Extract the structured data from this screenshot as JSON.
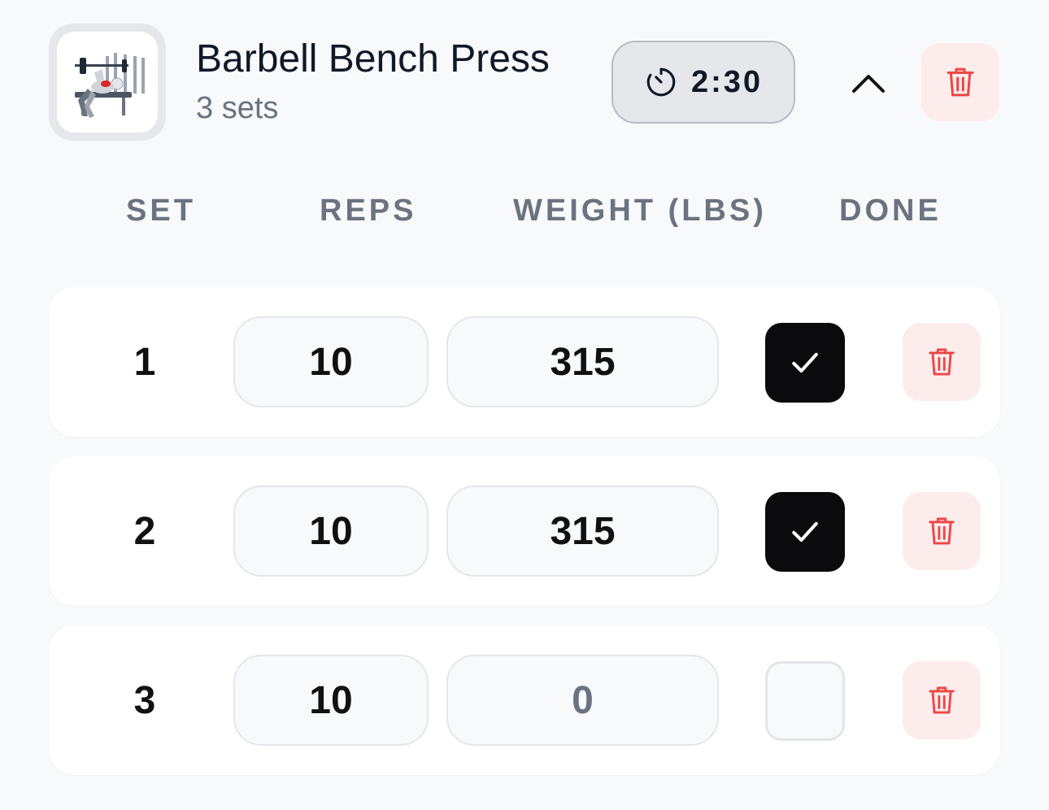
{
  "exercise": {
    "name": "Barbell Bench Press",
    "sets_label": "3 sets",
    "thumbnail_icon": "bench-press-illustration",
    "rest_timer": "2:30",
    "rest_timer_icon": "timer-icon",
    "collapse_icon": "chevron-up-icon",
    "delete_icon": "trash-icon"
  },
  "columns": {
    "set": "SET",
    "reps": "REPS",
    "weight": "WEIGHT (LBS)",
    "done": "DONE"
  },
  "sets": [
    {
      "number": "1",
      "reps": "10",
      "weight": "315",
      "done": true
    },
    {
      "number": "2",
      "reps": "10",
      "weight": "315",
      "done": true
    },
    {
      "number": "3",
      "reps": "10",
      "weight": "0",
      "done": false
    }
  ],
  "colors": {
    "background": "#f8f9fb",
    "text": "#111827",
    "muted": "#6b7280",
    "danger": "#ef4444",
    "danger_bg": "#fdecec",
    "checked": "#0b0b0d"
  }
}
